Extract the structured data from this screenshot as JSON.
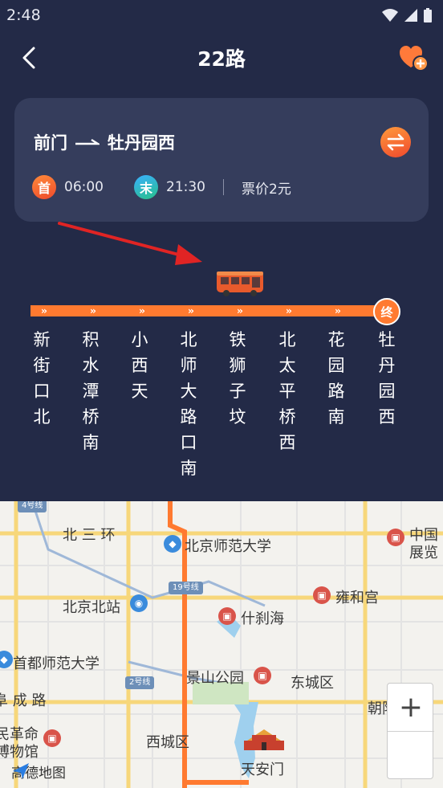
{
  "status_bar": {
    "time": "2:48"
  },
  "nav": {
    "title": "22路"
  },
  "route": {
    "origin": "前门",
    "destination": "牡丹园西",
    "first_badge": "首",
    "first_time": "06:00",
    "last_badge": "末",
    "last_time": "21:30",
    "fare": "票价2元"
  },
  "stations": [
    "新街口北",
    "积水潭桥南",
    "小西天",
    "北师大路口南",
    "铁狮子坟",
    "北太平桥西",
    "花园路南",
    "牡丹园西"
  ],
  "end_badge": "终",
  "map": {
    "labels": {
      "line4": "4号线",
      "bei_san_huan": "北 三 环",
      "bnu": "北京师范大学",
      "china_museum_1": "中国",
      "china_museum_2": "展览",
      "line19": "19号线",
      "yonghegong": "雍和宫",
      "beijing_north": "北京北站",
      "shichahai": "什刹海",
      "cnu": "首都师范大学",
      "jingshan": "景山公园",
      "dongcheng": "东城区",
      "line2": "2号线",
      "chengdu_road": "阜 成 路",
      "chaoyang": "朝阳",
      "revolution_1": "民革命",
      "revolution_2": "博物馆",
      "xicheng": "西城区",
      "tiananmen": "天安门",
      "amap": "高德地图"
    }
  },
  "colors": {
    "background": "#232a47",
    "card": "#353d5c",
    "track": "#ff7a30"
  }
}
